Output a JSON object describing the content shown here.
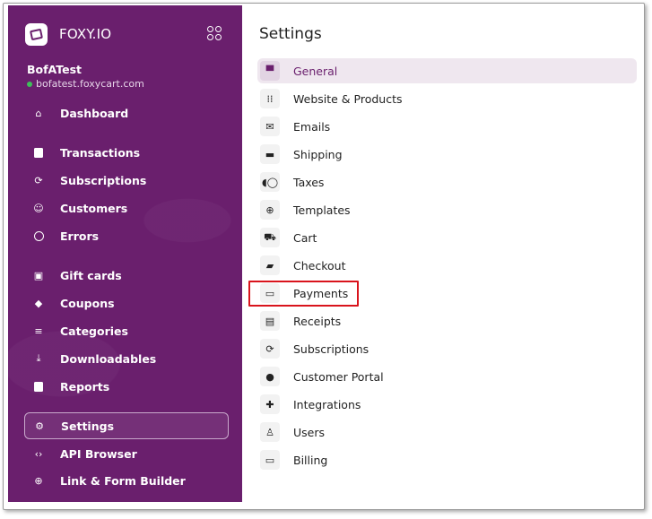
{
  "brand": {
    "name": "FOXY.IO"
  },
  "store": {
    "name": "BofATest",
    "domain": "bofatest.foxycart.com",
    "status_color": "#3fbf5a"
  },
  "sidebar": {
    "items": [
      {
        "label": "Dashboard",
        "icon": "home-icon"
      },
      {
        "label": "Transactions",
        "icon": "receipt-icon"
      },
      {
        "label": "Subscriptions",
        "icon": "sync-icon"
      },
      {
        "label": "Customers",
        "icon": "face-icon"
      },
      {
        "label": "Errors",
        "icon": "info-icon"
      },
      {
        "label": "Gift cards",
        "icon": "gift-icon"
      },
      {
        "label": "Coupons",
        "icon": "tag-icon"
      },
      {
        "label": "Categories",
        "icon": "list-icon"
      },
      {
        "label": "Downloadables",
        "icon": "download-icon"
      },
      {
        "label": "Reports",
        "icon": "chart-icon"
      },
      {
        "label": "Settings",
        "icon": "gear-icon",
        "active": true
      },
      {
        "label": "API Browser",
        "icon": "code-icon"
      },
      {
        "label": "Link & Form Builder",
        "icon": "cart-plus-icon"
      }
    ]
  },
  "main": {
    "title": "Settings",
    "items": [
      {
        "label": "General",
        "icon": "store-icon",
        "active": true
      },
      {
        "label": "Website & Products",
        "icon": "grid-icon"
      },
      {
        "label": "Emails",
        "icon": "mail-icon"
      },
      {
        "label": "Shipping",
        "icon": "truck-icon"
      },
      {
        "label": "Taxes",
        "icon": "tax-icon"
      },
      {
        "label": "Templates",
        "icon": "globe-icon"
      },
      {
        "label": "Cart",
        "icon": "cart-icon"
      },
      {
        "label": "Checkout",
        "icon": "wallet-icon"
      },
      {
        "label": "Payments",
        "icon": "credit-card-icon",
        "highlighted": true
      },
      {
        "label": "Receipts",
        "icon": "receipt-icon"
      },
      {
        "label": "Subscriptions",
        "icon": "sync-icon"
      },
      {
        "label": "Customer Portal",
        "icon": "account-icon"
      },
      {
        "label": "Integrations",
        "icon": "puzzle-icon"
      },
      {
        "label": "Users",
        "icon": "user-icon"
      },
      {
        "label": "Billing",
        "icon": "credit-card-icon"
      }
    ]
  },
  "colors": {
    "sidebar_bg": "#6a1f6d",
    "accent": "#6a1f6d",
    "highlight_box": "#d9141c"
  }
}
